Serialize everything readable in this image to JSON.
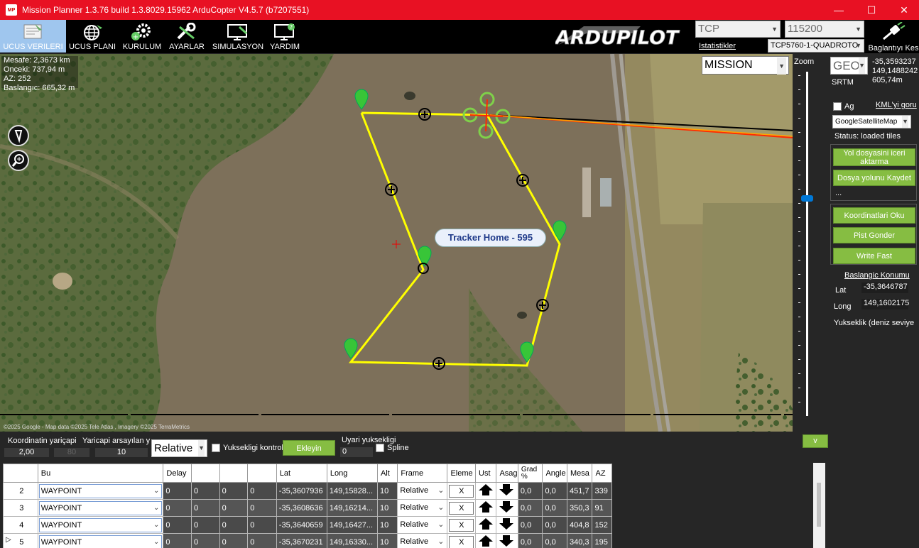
{
  "window": {
    "title": "Mission Planner 1.3.76 build 1.3.8029.15962 ArduCopter V4.5.7 (b7207551)",
    "app_icon": "MP"
  },
  "toolbar": {
    "items": [
      {
        "label": "UCUS VERILERI",
        "icon": "flight-data-icon",
        "active": true
      },
      {
        "label": "UCUS PLANI",
        "icon": "globe-icon"
      },
      {
        "label": "KURULUM",
        "icon": "gears-icon"
      },
      {
        "label": "AYARLAR",
        "icon": "wrench-icon"
      },
      {
        "label": "SIMULASYON",
        "icon": "monitor-plane-icon"
      },
      {
        "label": "YARDIM",
        "icon": "monitor-help-icon"
      }
    ],
    "logo_text": "ARDUPILOT",
    "connection_type": "TCP",
    "baud": "115200",
    "stats_link": "Istatistikler",
    "device": "TCP5760-1-QUADROTO",
    "disconnect_label": "Baglantıyı Kes"
  },
  "map": {
    "info": [
      "Mesafe: 2,3673 km",
      "Onceki: 737,94 m AZ: 252",
      "Baslangıc: 665,32 m"
    ],
    "mode_select": "MISSION",
    "tracker_label": "Tracker Home - 595",
    "attribution": "©2025 Google - Map data ©2025 Tele Atlas , Imagery ©2025 TerraMetrics"
  },
  "rightpanel": {
    "zoom_label": "Zoom",
    "geo_select": "GEO",
    "coords": [
      "-35,3593237",
      "149,1488242",
      "605,74m"
    ],
    "srtm": "SRTM",
    "ag_label": "Ag",
    "kml_link": "KML'yi goru",
    "map_source": "GoogleSatelliteMap",
    "status": "Status: loaded tiles",
    "buttons_top": [
      "Yol dosyasini iceri aktarma",
      "Dosya yolunu Kaydet"
    ],
    "ellipsis": "...",
    "buttons_bottom": [
      "Koordinatlari Oku",
      "Pist Gonder",
      "Write Fast"
    ],
    "home_title": "Baslangic Konumu",
    "lat_label": "Lat",
    "lat_value": "-35,3646787",
    "long_label": "Long",
    "long_value": "149,1602175",
    "alt_label": "Yukseklik (deniz seviye",
    "collapse_btn": "v"
  },
  "options": {
    "coord_radius_label": "Koordinatin yariçapi",
    "coord_radius": "2,00",
    "loiter_label": "Yaricapi arsayılan y",
    "loiter_val": "80",
    "default_alt": "10",
    "alt_mode": "Relative",
    "check_alt_label": "Yuksekligi kontrol et",
    "add_btn": "Ekleyin",
    "warn_alt_label": "Uyari yuksekligi",
    "warn_alt": "0",
    "spline_label": "Spline"
  },
  "table": {
    "headers": [
      "",
      "Bu",
      "Delay",
      "",
      "",
      "",
      "Lat",
      "Long",
      "Alt",
      "Frame",
      "Eleme",
      "Ust",
      "Asag",
      "Grad %",
      "Angle",
      "Mesa",
      "AZ"
    ],
    "rows": [
      {
        "n": "2",
        "cmd": "WAYPOINT",
        "p1": "0",
        "p2": "0",
        "p3": "0",
        "p4": "0",
        "lat": "-35,3607936",
        "lng": "149,15828...",
        "alt": "10",
        "frame": "Relative",
        "del": "X",
        "grad": "0,0",
        "angle": "0,0",
        "dist": "451,7",
        "az": "339"
      },
      {
        "n": "3",
        "cmd": "WAYPOINT",
        "p1": "0",
        "p2": "0",
        "p3": "0",
        "p4": "0",
        "lat": "-35,3608636",
        "lng": "149,16214...",
        "alt": "10",
        "frame": "Relative",
        "del": "X",
        "grad": "0,0",
        "angle": "0,0",
        "dist": "350,3",
        "az": "91"
      },
      {
        "n": "4",
        "cmd": "WAYPOINT",
        "p1": "0",
        "p2": "0",
        "p3": "0",
        "p4": "0",
        "lat": "-35,3640659",
        "lng": "149,16427...",
        "alt": "10",
        "frame": "Relative",
        "del": "X",
        "grad": "0,0",
        "angle": "0,0",
        "dist": "404,8",
        "az": "152"
      },
      {
        "n": "5",
        "cmd": "WAYPOINT",
        "p1": "0",
        "p2": "0",
        "p3": "0",
        "p4": "0",
        "lat": "-35,3670231",
        "lng": "149,16330...",
        "alt": "10",
        "frame": "Relative",
        "del": "X",
        "grad": "0,0",
        "angle": "0,0",
        "dist": "340,3",
        "az": "195"
      }
    ]
  },
  "colors": {
    "titlebar": "#e81123",
    "button_green": "#86bd42",
    "route": "#ffff00",
    "active_tab": "#9fc6ee"
  }
}
